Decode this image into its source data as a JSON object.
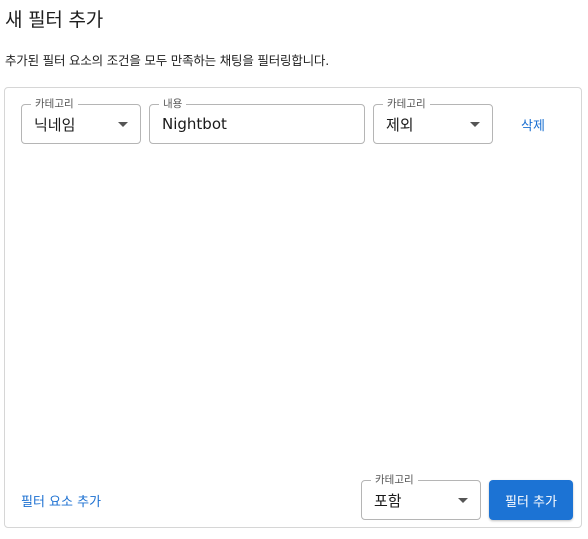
{
  "dialog": {
    "title": "새 필터 추가",
    "description": "추가된 필터 요소의 조건을 모두 만족하는 채팅을 필터링합니다."
  },
  "filter_rows": [
    {
      "category": {
        "label": "카테고리",
        "value": "닉네임",
        "icon": "caret-down-icon"
      },
      "content": {
        "label": "내용",
        "value": "Nightbot"
      },
      "mode": {
        "label": "카테고리",
        "value": "제외",
        "icon": "caret-down-icon"
      },
      "delete_label": "삭제"
    }
  ],
  "footer": {
    "add_element_label": "필터 요소 추가",
    "mode_select": {
      "label": "카테고리",
      "value": "포함",
      "icon": "caret-down-icon"
    },
    "add_filter_label": "필터 추가"
  },
  "colors": {
    "accent": "#1c73d4",
    "link": "#1a6fd1",
    "border": "#b5b5b5"
  }
}
